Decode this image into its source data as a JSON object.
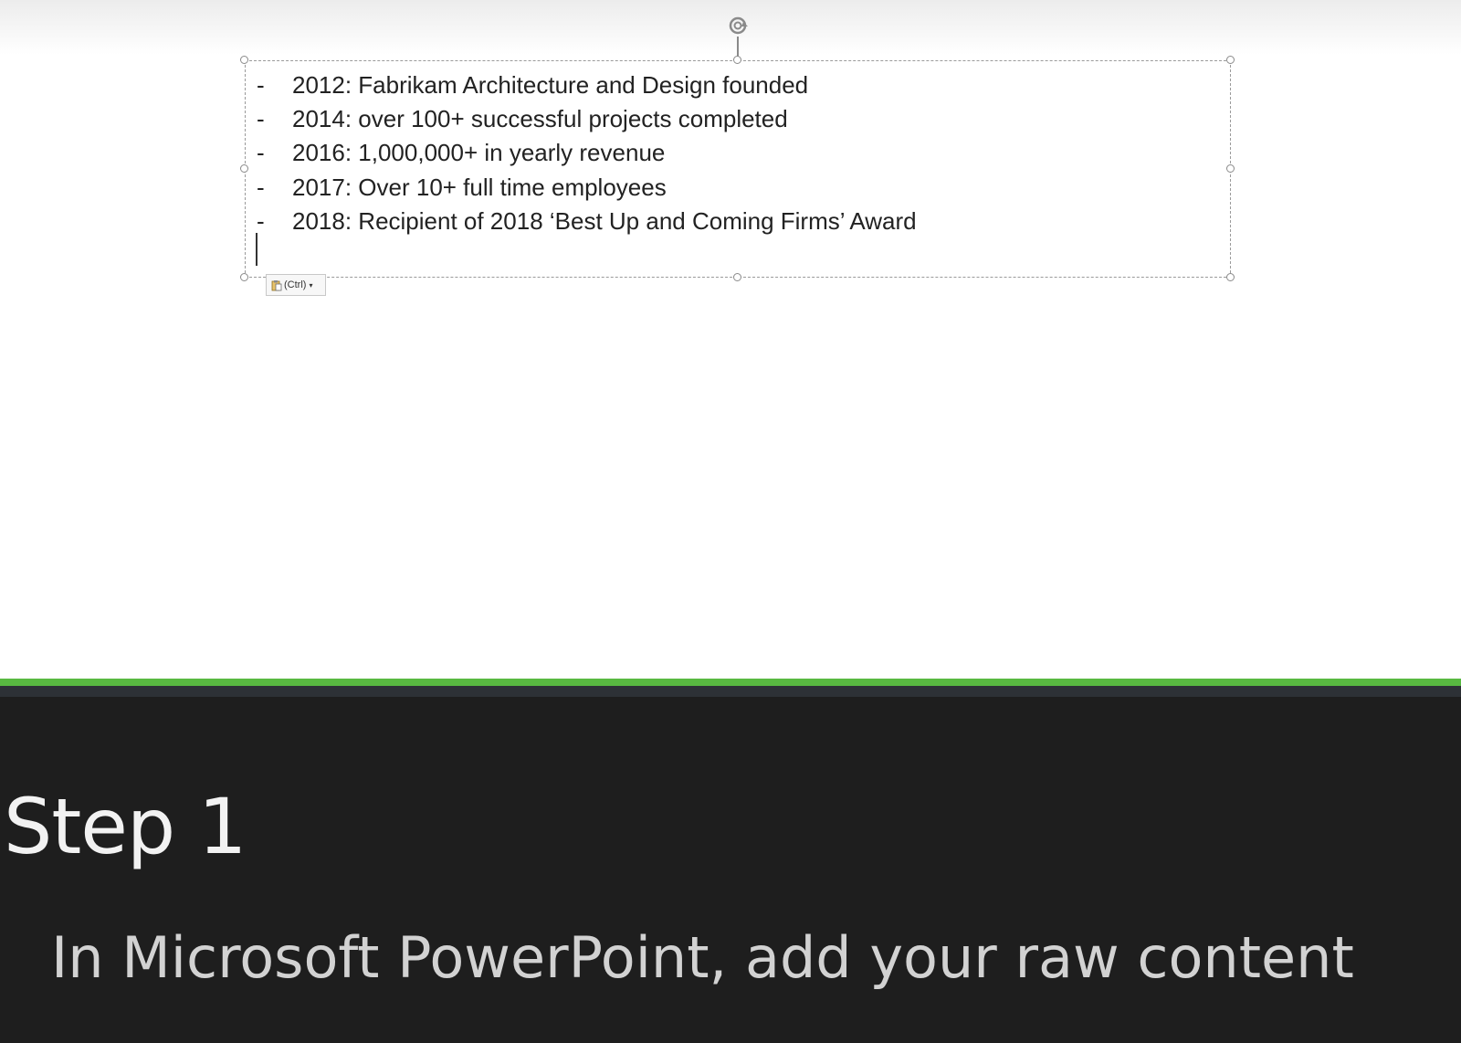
{
  "slide": {
    "bullets": [
      {
        "marker": "-",
        "text": "2012: Fabrikam Architecture and Design founded"
      },
      {
        "marker": "-",
        "text": "2014: over 100+ successful projects completed"
      },
      {
        "marker": "-",
        "text": "2016: 1,000,000+ in yearly revenue"
      },
      {
        "marker": "-",
        "text": "2017: Over 10+ full time employees"
      },
      {
        "marker": "-",
        "text": "2018: Recipient of 2018 ‘Best Up and Coming Firms’ Award"
      }
    ],
    "paste_options": {
      "label": "(Ctrl)",
      "caret": "▾",
      "icon": "paste-clipboard-icon"
    }
  },
  "caption": {
    "step": "Step 1",
    "description": "In Microsoft PowerPoint, add your raw content"
  },
  "colors": {
    "accent_green": "#58b941",
    "caption_background": "#1e1e1e",
    "stripe_dark": "#2d3136"
  }
}
